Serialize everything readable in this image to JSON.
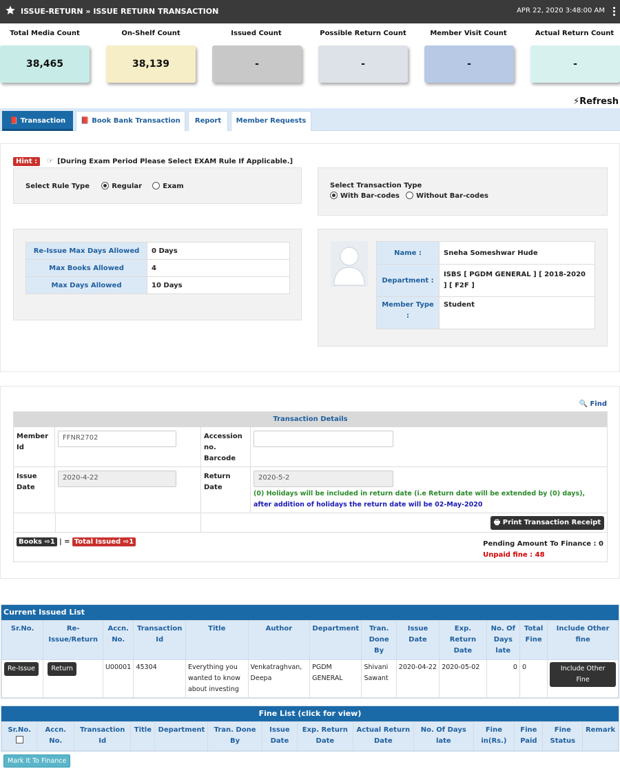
{
  "header": {
    "title": "ISSUE-RETURN » ISSUE RETURN TRANSACTION",
    "datetime": "APR 22, 2020  3:48:00 AM"
  },
  "stats": [
    {
      "label": "Total Media Count",
      "value": "38,465",
      "color": "#c7ece8"
    },
    {
      "label": "On-Shelf Count",
      "value": "38,139",
      "color": "#f6eec6"
    },
    {
      "label": "Issued Count",
      "value": "-",
      "color": "#c8c8c8"
    },
    {
      "label": "Possible Return Count",
      "value": "-",
      "color": "#dde2e8"
    },
    {
      "label": "Member Visit Count",
      "value": "-",
      "color": "#b7c9e4"
    },
    {
      "label": "Actual Return Count",
      "value": "-",
      "color": "#d7f1ef"
    }
  ],
  "refresh_label": "Refresh",
  "tabs": [
    {
      "label": "Transaction"
    },
    {
      "label": "Book Bank Transaction"
    },
    {
      "label": "Report"
    },
    {
      "label": "Member Requests"
    }
  ],
  "hint": {
    "badge": "Hint :",
    "text": "[During Exam Period Please Select EXAM Rule If Applicable.]"
  },
  "rule_type": {
    "label": "Select Rule Type",
    "options": [
      "Regular",
      "Exam"
    ],
    "selected": "Regular"
  },
  "transaction_type": {
    "label": "Select Transaction Type",
    "options": [
      "With Bar-codes",
      "Without Bar-codes"
    ],
    "selected": "With Bar-codes"
  },
  "rules": [
    {
      "key": "Re-Issue Max Days Allowed",
      "value": "0 Days"
    },
    {
      "key": "Max Books Allowed",
      "value": "4"
    },
    {
      "key": "Max Days Allowed",
      "value": "10 Days"
    }
  ],
  "member": {
    "name_label": "Name :",
    "name": "Sneha Someshwar Hude",
    "dept_label": "Department :",
    "dept": "ISBS [ PGDM GENERAL ] [ 2018-2020 ] [ F2F ]",
    "type_label": "Member Type :",
    "type": "Student"
  },
  "find_label": "Find",
  "transaction_details": {
    "title": "Transaction Details",
    "member_id_label": "Member Id",
    "member_id_value": "FFNR2702",
    "accession_label": "Accession no. Barcode",
    "accession_value": "",
    "issue_date_label": "Issue Date",
    "issue_date_value": "2020-4-22",
    "return_date_label": "Return Date",
    "return_date_value": "2020-5-2",
    "holiday_note_green": "(0) Holidays will be included in return date (i.e Return date will be extended by (0) days),",
    "holiday_note_blue": "after addition of holidays the return date will be 02-May-2020",
    "print_button": "Print Transaction Receipt",
    "books_badge": "Books",
    "books_count": "1",
    "equals": "| =",
    "total_badge": "Total Issued",
    "total_count": "1",
    "pending_label": "Pending Amount To Finance : 0",
    "unpaid_label": "Unpaid fine : 48"
  },
  "issued_list": {
    "title": "Current Issued List",
    "columns": [
      "Sr.No.",
      "Re-Issue/Return",
      "Accn. No.",
      "Transaction Id",
      "Title",
      "Author",
      "Department",
      "Tran. Done By",
      "Issue Date",
      "Exp. Return Date",
      "No. Of Days late",
      "Total Fine",
      "Include Other fine"
    ],
    "rows": [
      {
        "reissue": "Re-Issue",
        "return": "Return",
        "accn": "U00001",
        "txn": "45304",
        "title": "Everything you wanted to know about investing",
        "author": "Venkatraghvan, Deepa",
        "department": "PGDM GENERAL",
        "done_by": "Shivani Sawant",
        "issue_date": "2020-04-22",
        "exp_return": "2020-05-02",
        "days_late": "0",
        "total_fine": "0",
        "include_btn": "Include Other Fine"
      }
    ]
  },
  "fine_list": {
    "title": "Fine List  (click for view)",
    "columns": [
      "Sr.No.",
      "Accn. No.",
      "Transaction Id",
      "Title",
      "Department",
      "Tran. Done By",
      "Issue Date",
      "Exp. Return Date",
      "Actual Return Date",
      "No. Of Days late",
      "Fine in(Rs.)",
      "Fine Paid",
      "Fine Status",
      "Remark"
    ],
    "mark_button": "Mark It To Finance"
  }
}
